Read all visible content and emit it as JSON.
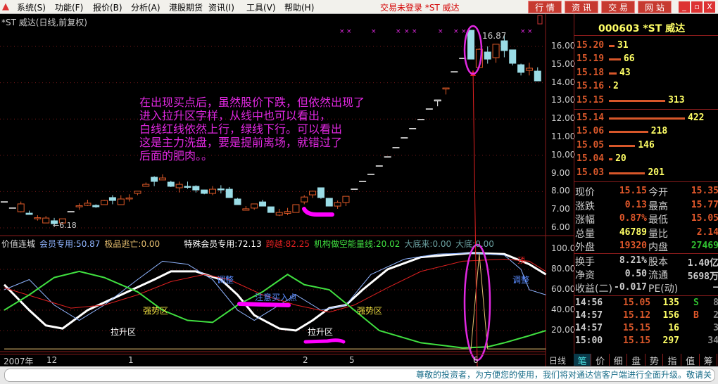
{
  "menu": {
    "items": [
      "系统(S)",
      "功能(F)",
      "报价(B)",
      "分析(A)",
      "港股期货",
      "资讯(I)",
      "工具(V)",
      "帮助(H)"
    ],
    "title": "交易未登录 *ST 威达",
    "buttons": [
      "行 情",
      "资 讯",
      "交 易",
      "网 站"
    ],
    "win": [
      "_",
      "▫",
      "X"
    ]
  },
  "chart": {
    "title": "*ST 威达(日线,前复权)",
    "low_label": "←6.18",
    "high_label": "16.87",
    "price_ticks": [
      "16.00",
      "15.00",
      "14.00",
      "13.00",
      "12.00",
      "11.00",
      "10.00",
      "9.00",
      "8.00",
      "7.00",
      "6.00"
    ],
    "indicator_ticks": [
      "100.0",
      "80.00",
      "60.00",
      "40.00",
      "20.00"
    ],
    "indicator_legend": [
      {
        "t": "价值连城",
        "c": "#dddddd"
      },
      {
        "t": "会员专用:50.87",
        "c": "#8fb4ff"
      },
      {
        "t": "极品逃亡:0.00",
        "c": "#e8c070"
      },
      {
        "t": "特殊会员专用:72.13",
        "c": "#ffffff"
      },
      {
        "t": "跨越:82.25",
        "c": "#e02020"
      },
      {
        "t": "机构做空能量线:20.02",
        "c": "#40e040"
      },
      {
        "t": "大底来:0.00",
        "c": "#6aa0a0"
      },
      {
        "t": "大底:0.00",
        "c": "#6aa0a0"
      }
    ],
    "annotation": [
      "在出现买点后，虽然股价下跌，但依然出现了",
      "进入拉升区字样，从线中也可以看出，",
      "白线红线依然上行，绿线下行。可以看出",
      "这是主力洗盘，要是提前离场，就错过了",
      "后面的肥肉。。"
    ],
    "labels": {
      "adjust1": "调整",
      "adjust2": "调整",
      "strong1": "强势区",
      "strong2": "强势区",
      "rise1": "拉升区",
      "rise2": "拉升区",
      "buy": "注意买入点",
      "top": "顶"
    },
    "date_axis": [
      "2007年",
      "12",
      "1",
      "2",
      "5",
      "6"
    ],
    "period": "日线"
  },
  "chart_data": {
    "type": "candlestick",
    "price_range": [
      6,
      16
    ],
    "candles": [
      [
        7.43,
        7.43,
        7.43,
        7.43
      ],
      [
        7.09,
        7.09,
        7.09,
        7.09
      ],
      [
        6.89,
        7.32,
        7.45,
        6.85
      ],
      [
        6.81,
        6.74,
        6.95,
        6.74
      ],
      [
        6.54,
        6.56,
        6.7,
        6.4
      ],
      [
        6.27,
        6.54,
        6.65,
        6.27
      ],
      [
        6.39,
        6.23,
        6.55,
        6.18
      ],
      [
        6.27,
        6.5,
        6.5,
        6.2
      ],
      [
        6.89,
        6.89,
        6.89,
        6.89
      ],
      [
        7.18,
        7.22,
        7.35,
        7.0
      ],
      [
        7.24,
        7.36,
        7.55,
        7.2
      ],
      [
        7.24,
        7.16,
        7.3,
        7.1
      ],
      [
        7.28,
        7.51,
        7.55,
        7.28
      ],
      [
        7.67,
        7.51,
        7.8,
        7.3
      ],
      [
        7.28,
        7.59,
        7.8,
        7.28
      ],
      [
        7.62,
        7.65,
        7.85,
        7.45
      ],
      [
        7.9,
        8.02,
        8.02,
        7.8
      ],
      [
        8.29,
        8.4,
        8.5,
        8.29
      ],
      [
        8.79,
        8.56,
        8.85,
        8.3
      ],
      [
        8.64,
        8.75,
        8.95,
        8.64
      ],
      [
        8.52,
        8.29,
        8.6,
        8.25
      ],
      [
        8.21,
        8.4,
        8.55,
        7.95
      ],
      [
        8.29,
        8.27,
        8.55,
        8.15
      ],
      [
        8.29,
        8.09,
        8.35,
        7.95
      ],
      [
        8.09,
        7.9,
        8.1,
        7.85
      ],
      [
        7.9,
        8.13,
        8.3,
        7.8
      ],
      [
        8.15,
        8.13,
        8.35,
        7.9
      ],
      [
        8.13,
        7.67,
        8.25,
        7.67
      ],
      [
        7.59,
        7.28,
        7.65,
        7.28
      ],
      [
        6.97,
        7.05,
        7.2,
        6.95
      ],
      [
        7.09,
        7.32,
        7.32,
        7.0
      ],
      [
        7.43,
        7.2,
        7.55,
        7.2
      ],
      [
        7.16,
        6.85,
        7.16,
        6.85
      ],
      [
        6.7,
        6.85,
        7.05,
        6.65
      ],
      [
        6.8,
        6.9,
        7.1,
        6.7
      ],
      [
        6.85,
        7.28,
        7.3,
        6.85
      ],
      [
        7.43,
        7.7,
        7.8,
        7.3
      ],
      [
        7.82,
        8.02,
        8.05,
        7.65
      ],
      [
        8.21,
        7.67,
        8.21,
        7.6
      ],
      [
        7.63,
        7.2,
        7.63,
        7.2
      ],
      [
        7.2,
        7.4,
        7.5,
        7.05
      ],
      [
        7.4,
        7.74,
        7.74,
        7.2
      ],
      [
        8.13,
        8.13,
        8.13,
        8.13
      ],
      [
        8.56,
        8.56,
        8.56,
        8.56
      ],
      [
        8.95,
        8.95,
        8.95,
        8.95
      ],
      [
        9.41,
        9.41,
        9.41,
        9.41
      ],
      [
        9.91,
        9.91,
        9.91,
        9.91
      ],
      [
        10.42,
        10.42,
        10.42,
        10.42
      ],
      [
        10.96,
        10.96,
        10.96,
        10.96
      ],
      [
        11.47,
        11.47,
        11.47,
        11.47
      ],
      [
        11.97,
        11.97,
        11.97,
        11.97
      ],
      [
        12.55,
        12.55,
        12.55,
        12.55
      ],
      [
        13.05,
        13.05,
        13.05,
        12.7
      ],
      [
        13.7,
        13.71,
        13.71,
        13.35
      ],
      [
        14.6,
        14.6,
        14.6,
        14.6
      ],
      [
        15.34,
        15.34,
        15.34,
        15.34
      ],
      [
        16.89,
        15.3,
        16.89,
        15.3
      ],
      [
        14.84,
        15.84,
        15.9,
        14.84
      ],
      [
        15.69,
        15.3,
        16.0,
        15.05
      ],
      [
        15.38,
        16.12,
        16.12,
        15.1
      ],
      [
        16.31,
        15.77,
        16.6,
        15.4
      ],
      [
        15.81,
        15.07,
        15.81,
        14.95
      ],
      [
        14.99,
        14.57,
        15.05,
        14.4
      ],
      [
        14.68,
        14.8,
        15.1,
        14.4
      ],
      [
        14.64,
        14.1,
        14.85,
        14.1
      ]
    ],
    "indicator_range": [
      0,
      100
    ],
    "series": [
      {
        "name": "特殊会员专用",
        "color": "#ffffff",
        "width": 3,
        "points": [
          [
            0,
            65
          ],
          [
            3,
            40
          ],
          [
            5,
            25
          ],
          [
            7,
            22
          ],
          [
            10,
            40
          ],
          [
            14,
            55
          ],
          [
            18,
            70
          ],
          [
            20,
            78
          ],
          [
            23,
            78
          ],
          [
            26,
            70
          ],
          [
            28,
            55
          ],
          [
            30,
            35
          ],
          [
            33,
            22
          ],
          [
            35,
            20
          ],
          [
            37,
            30
          ],
          [
            39,
            42
          ],
          [
            41,
            45
          ],
          [
            43,
            60
          ],
          [
            46,
            80
          ],
          [
            50,
            92
          ],
          [
            56,
            96
          ],
          [
            60,
            95
          ],
          [
            63,
            85
          ],
          [
            65,
            75
          ]
        ]
      },
      {
        "name": "会员专用",
        "color": "#8fb4ff",
        "width": 1,
        "points": [
          [
            0,
            60
          ],
          [
            3,
            70
          ],
          [
            6,
            45
          ],
          [
            9,
            30
          ],
          [
            12,
            45
          ],
          [
            16,
            70
          ],
          [
            19,
            88
          ],
          [
            22,
            85
          ],
          [
            25,
            70
          ],
          [
            28,
            40
          ],
          [
            30,
            30
          ],
          [
            33,
            45
          ],
          [
            35,
            55
          ],
          [
            38,
            40
          ],
          [
            41,
            45
          ],
          [
            44,
            75
          ],
          [
            48,
            90
          ],
          [
            52,
            95
          ],
          [
            56,
            96
          ],
          [
            60,
            94
          ],
          [
            62,
            80
          ],
          [
            63,
            60
          ],
          [
            65,
            55
          ]
        ]
      },
      {
        "name": "跨越",
        "color": "#e02020",
        "width": 1,
        "points": [
          [
            0,
            62
          ],
          [
            4,
            52
          ],
          [
            8,
            42
          ],
          [
            12,
            45
          ],
          [
            16,
            55
          ],
          [
            20,
            68
          ],
          [
            24,
            75
          ],
          [
            27,
            70
          ],
          [
            31,
            55
          ],
          [
            35,
            45
          ],
          [
            39,
            38
          ],
          [
            42,
            45
          ],
          [
            46,
            62
          ],
          [
            50,
            78
          ],
          [
            55,
            88
          ],
          [
            60,
            90
          ],
          [
            63,
            88
          ],
          [
            65,
            78
          ]
        ]
      },
      {
        "name": "机构做空能量线",
        "color": "#40e040",
        "width": 2,
        "points": [
          [
            0,
            40
          ],
          [
            3,
            55
          ],
          [
            6,
            72
          ],
          [
            9,
            78
          ],
          [
            12,
            72
          ],
          [
            16,
            58
          ],
          [
            19,
            40
          ],
          [
            22,
            30
          ],
          [
            25,
            28
          ],
          [
            28,
            45
          ],
          [
            31,
            58
          ],
          [
            34,
            75
          ],
          [
            36,
            65
          ],
          [
            39,
            60
          ],
          [
            42,
            40
          ],
          [
            45,
            20
          ],
          [
            50,
            8
          ],
          [
            55,
            3
          ],
          [
            58,
            4
          ],
          [
            60,
            8
          ],
          [
            63,
            15
          ],
          [
            65,
            20
          ]
        ]
      },
      {
        "name": "极品逃亡",
        "color": "#e8c070",
        "width": 1,
        "points": [
          [
            0,
            2
          ],
          [
            56,
            2
          ],
          [
            57,
            95
          ],
          [
            58,
            2
          ],
          [
            65,
            2
          ]
        ]
      }
    ]
  },
  "quote": {
    "title": "000603 *ST 威达",
    "asks": [
      {
        "p": "15.20",
        "v": 31
      },
      {
        "p": "15.19",
        "v": 66
      },
      {
        "p": "15.18",
        "v": 43
      },
      {
        "p": "15.16",
        "v": 2
      },
      {
        "p": "15.15",
        "v": 313
      }
    ],
    "bids": [
      {
        "p": "15.14",
        "v": 422
      },
      {
        "p": "15.06",
        "v": 218
      },
      {
        "p": "15.05",
        "v": 146
      },
      {
        "p": "15.04",
        "v": 20
      },
      {
        "p": "15.03",
        "v": 201
      }
    ],
    "stats": [
      [
        "现价",
        "15.15",
        "今开",
        "15.35"
      ],
      [
        "涨跌",
        "0.13",
        "最高",
        "15.77"
      ],
      [
        "涨幅",
        "0.87%",
        "最低",
        "15.05"
      ],
      [
        "总量",
        "46789",
        "量比",
        "2.14"
      ],
      [
        "外盘",
        "19320",
        "内盘",
        "27469"
      ]
    ],
    "fin": [
      [
        "换手",
        "8.21%",
        "股本",
        "1.40亿"
      ],
      [
        "净资",
        "0.50",
        "流通",
        "5698万"
      ],
      [
        "收益(二)",
        "-0.017",
        "PE(动)",
        "—"
      ]
    ],
    "ticks": [
      [
        "14:56",
        "15.05",
        "135",
        "S",
        "8"
      ],
      [
        "14:57",
        "15.12",
        "156",
        "B",
        "2"
      ],
      [
        "14:57",
        "15.15",
        "16",
        "",
        "3"
      ],
      [
        "15:00",
        "15.15",
        "297",
        "",
        "34"
      ]
    ],
    "tabs": [
      "笔",
      "价",
      "细",
      "盘",
      "势",
      "指",
      "值",
      "筹"
    ]
  },
  "status": "尊敬的投资者，为方便您的使用，我们将对通达信客户端进行全面升级。敬请关"
}
